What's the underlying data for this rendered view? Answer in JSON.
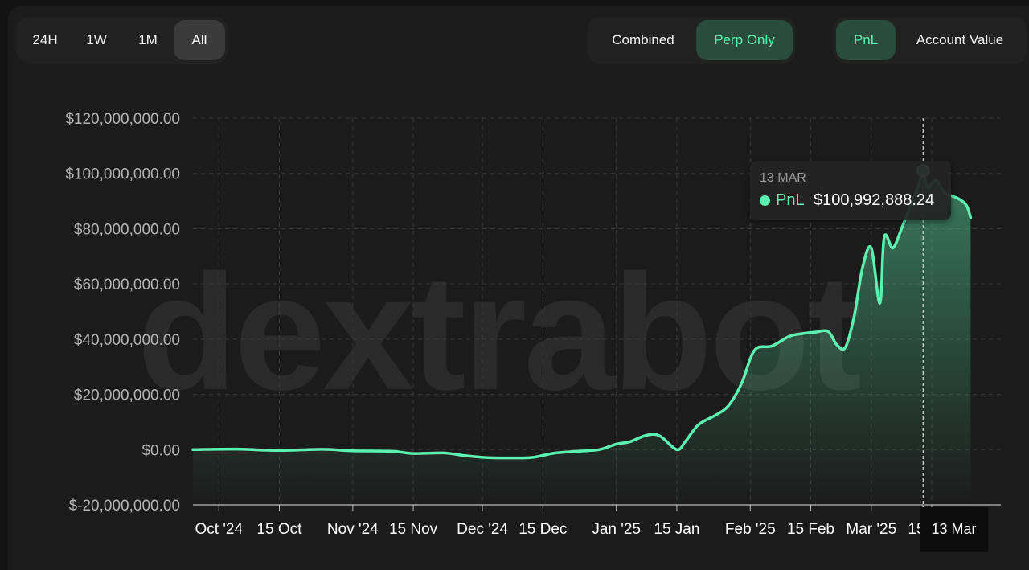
{
  "controls": {
    "ranges": [
      {
        "label": "24H",
        "active": false
      },
      {
        "label": "1W",
        "active": false
      },
      {
        "label": "1M",
        "active": false
      },
      {
        "label": "All",
        "active": true
      }
    ],
    "modes": [
      {
        "label": "Combined",
        "active": false
      },
      {
        "label": "Perp Only",
        "active": true
      }
    ],
    "metrics": [
      {
        "label": "PnL",
        "active": true
      },
      {
        "label": "Account Value",
        "active": false
      }
    ]
  },
  "watermark": "dextrabot",
  "tooltip": {
    "date": "13 MAR",
    "series": "PnL",
    "value": "$100,992,888.24"
  },
  "cursor_label": "13 Mar",
  "colors": {
    "line": "#5ef0b0",
    "accent_bg": "#2a4c3c",
    "background": "#1b1b1b"
  },
  "chart_data": {
    "type": "area",
    "title": "",
    "xlabel": "",
    "ylabel": "",
    "ylim": [
      -20000000,
      120000000
    ],
    "yticks": [
      {
        "value": 120000000,
        "label": "$120,000,000.00"
      },
      {
        "value": 100000000,
        "label": "$100,000,000.00"
      },
      {
        "value": 80000000,
        "label": "$80,000,000.00"
      },
      {
        "value": 60000000,
        "label": "$60,000,000.00"
      },
      {
        "value": 40000000,
        "label": "$40,000,000.00"
      },
      {
        "value": 20000000,
        "label": "$20,000,000.00"
      },
      {
        "value": 0,
        "label": "$0.00"
      },
      {
        "value": -20000000,
        "label": "$-20,000,000.00"
      }
    ],
    "xlim": [
      "2024-09-25",
      "2025-03-31"
    ],
    "xticks": [
      {
        "date": "2024-10-01",
        "label": "Oct '24"
      },
      {
        "date": "2024-10-15",
        "label": "15 Oct"
      },
      {
        "date": "2024-11-01",
        "label": "Nov '24"
      },
      {
        "date": "2024-11-15",
        "label": "15 Nov"
      },
      {
        "date": "2024-12-01",
        "label": "Dec '24"
      },
      {
        "date": "2024-12-15",
        "label": "15 Dec"
      },
      {
        "date": "2025-01-01",
        "label": "Jan '25"
      },
      {
        "date": "2025-01-15",
        "label": "15 Jan"
      },
      {
        "date": "2025-02-01",
        "label": "Feb '25"
      },
      {
        "date": "2025-02-15",
        "label": "15 Feb"
      },
      {
        "date": "2025-03-01",
        "label": "Mar '25"
      },
      {
        "date": "2025-03-15",
        "label": "15 Mar"
      }
    ],
    "grid": true,
    "highlight": {
      "date": "2025-03-13",
      "value": 100992888.24
    },
    "series": [
      {
        "name": "PnL",
        "fill": "from 2025-03-13",
        "points": [
          [
            "2024-09-25",
            0
          ],
          [
            "2024-10-05",
            200000
          ],
          [
            "2024-10-15",
            -300000
          ],
          [
            "2024-10-25",
            100000
          ],
          [
            "2024-11-01",
            -400000
          ],
          [
            "2024-11-10",
            -600000
          ],
          [
            "2024-11-15",
            -1400000
          ],
          [
            "2024-11-22",
            -1200000
          ],
          [
            "2024-11-27",
            -2200000
          ],
          [
            "2024-12-01",
            -2800000
          ],
          [
            "2024-12-05",
            -3000000
          ],
          [
            "2024-12-12",
            -2900000
          ],
          [
            "2024-12-15",
            -2100000
          ],
          [
            "2024-12-18",
            -1200000
          ],
          [
            "2024-12-23",
            -600000
          ],
          [
            "2024-12-28",
            0
          ],
          [
            "2025-01-01",
            2000000
          ],
          [
            "2025-01-04",
            2800000
          ],
          [
            "2025-01-08",
            5200000
          ],
          [
            "2025-01-11",
            5000000
          ],
          [
            "2025-01-15",
            0
          ],
          [
            "2025-01-17",
            3000000
          ],
          [
            "2025-01-20",
            9000000
          ],
          [
            "2025-01-24",
            12500000
          ],
          [
            "2025-01-27",
            16000000
          ],
          [
            "2025-01-30",
            24000000
          ],
          [
            "2025-02-02",
            36000000
          ],
          [
            "2025-02-06",
            37500000
          ],
          [
            "2025-02-10",
            41000000
          ],
          [
            "2025-02-13",
            42000000
          ],
          [
            "2025-02-16",
            42500000
          ],
          [
            "2025-02-19",
            42800000
          ],
          [
            "2025-02-21",
            38000000
          ],
          [
            "2025-02-23",
            37000000
          ],
          [
            "2025-02-25",
            48000000
          ],
          [
            "2025-02-27",
            66000000
          ],
          [
            "2025-03-01",
            73000000
          ],
          [
            "2025-03-03",
            53000000
          ],
          [
            "2025-03-04",
            77000000
          ],
          [
            "2025-03-06",
            73000000
          ],
          [
            "2025-03-08",
            80000000
          ],
          [
            "2025-03-10",
            88000000
          ],
          [
            "2025-03-12",
            96000000
          ],
          [
            "2025-03-13",
            100992888.24
          ],
          [
            "2025-03-14",
            95000000
          ],
          [
            "2025-03-16",
            97500000
          ],
          [
            "2025-03-18",
            93000000
          ],
          [
            "2025-03-21",
            91000000
          ],
          [
            "2025-03-23",
            88500000
          ],
          [
            "2025-03-24",
            84000000
          ]
        ]
      }
    ]
  }
}
